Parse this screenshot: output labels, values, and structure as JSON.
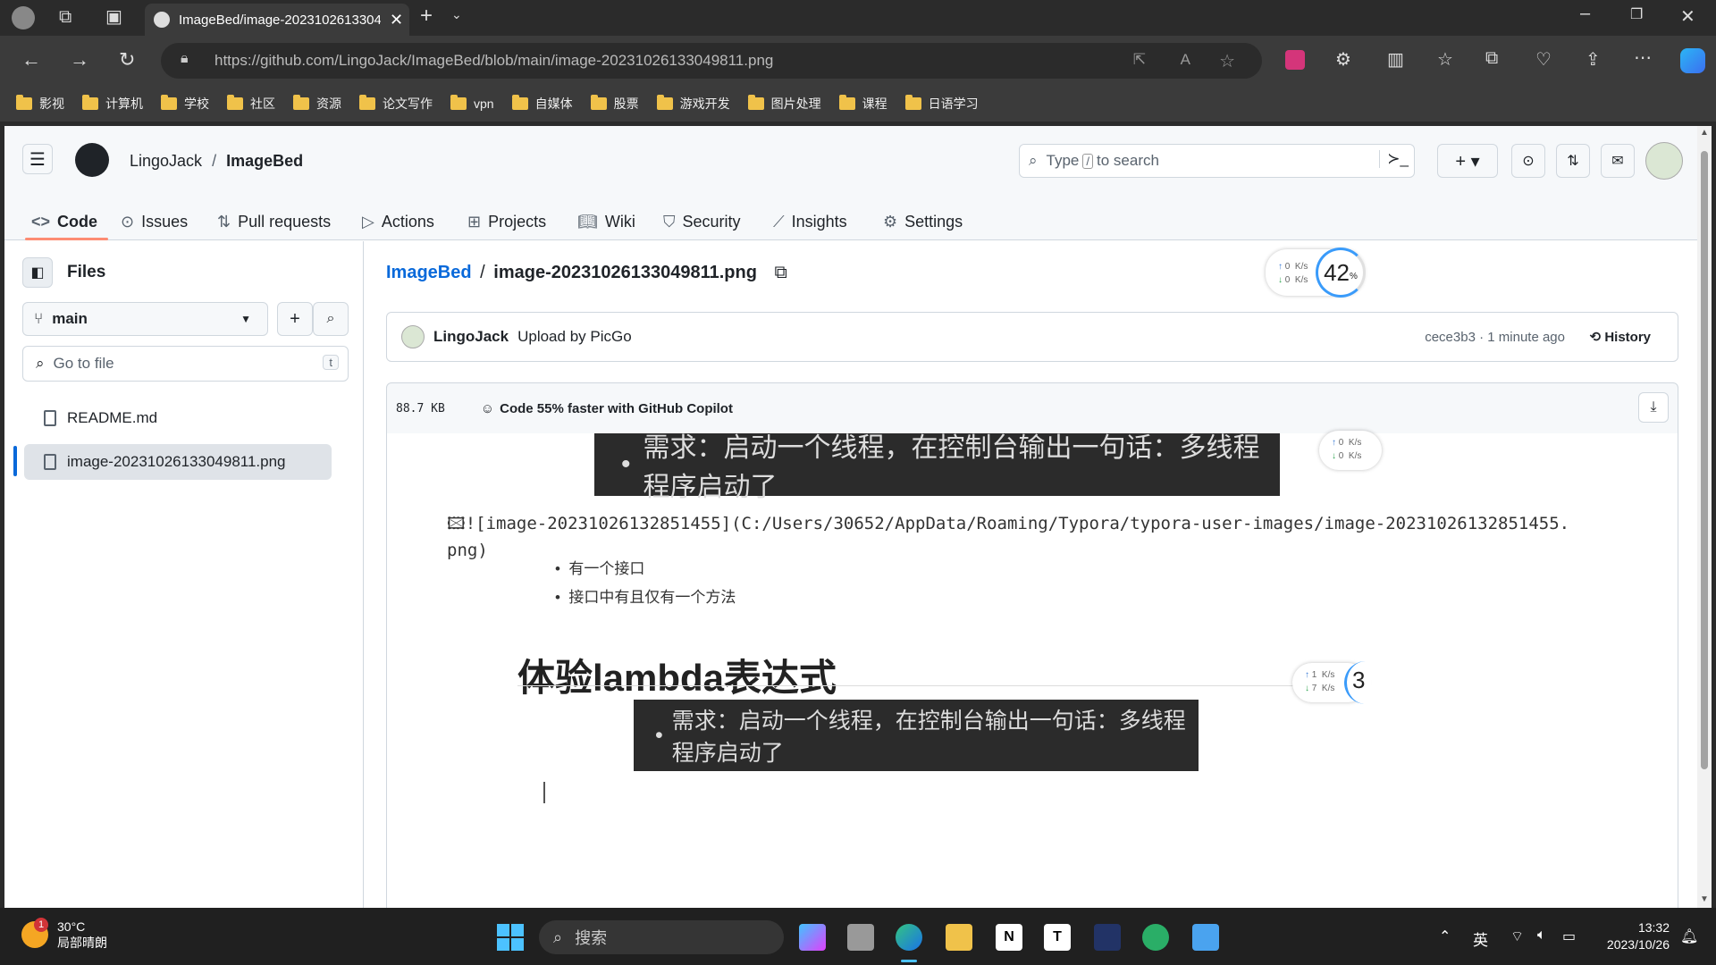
{
  "browser": {
    "tab_title": "ImageBed/image-20231026133049811.png",
    "url": "https://github.com/LingoJack/ImageBed/blob/main/image-20231026133049811.png",
    "bookmarks": [
      "影视",
      "计算机",
      "学校",
      "社区",
      "资源",
      "论文写作",
      "vpn",
      "自媒体",
      "股票",
      "游戏开发",
      "图片处理",
      "课程",
      "日语学习"
    ]
  },
  "repo": {
    "owner": "LingoJack",
    "separator": "/",
    "name": "ImageBed"
  },
  "search": {
    "placeholder_pre": "Type",
    "key": "/",
    "placeholder_post": "to search"
  },
  "nav": {
    "code": "Code",
    "issues": "Issues",
    "pulls": "Pull requests",
    "actions": "Actions",
    "projects": "Projects",
    "wiki": "Wiki",
    "security": "Security",
    "insights": "Insights",
    "settings": "Settings"
  },
  "sidebar": {
    "title": "Files",
    "branch": "main",
    "goto_placeholder": "Go to file",
    "goto_key": "t",
    "files": [
      "README.md",
      "image-20231026133049811.png"
    ]
  },
  "file": {
    "repo_link": "ImageBed",
    "sep": "/",
    "name": "image-20231026133049811.png",
    "author": "LingoJack",
    "commit_msg": "Upload by PicGo",
    "commit_meta": "cece3b3 · 1 minute ago",
    "history": "History",
    "size": "88.7 KB",
    "copilot": "Code 55% faster with GitHub Copilot"
  },
  "image_content": {
    "req1": "需求：启动一个线程，在控制台输出一句话：多线程程序启动了",
    "md_line1": "![image-20231026132851455](C:/Users/30652/AppData/Roaming/Typora/typora-user-images/image-20231026132851455.",
    "md_line2": "png)",
    "bullet1": "有一个接口",
    "bullet2": "接口中有且仅有一个方法",
    "heading": "体验lambda表达式",
    "req2": "需求：启动一个线程，在控制台输出一句话：多线程程序启动了"
  },
  "widgets": {
    "percent": "42",
    "percent_unit": "%",
    "up": "0",
    "down": "0",
    "unit": "K/s",
    "up2": "1",
    "down2": "7",
    "partial": "3"
  },
  "taskbar": {
    "temp": "30°C",
    "weather": "局部晴朗",
    "badge": "1",
    "search": "搜索",
    "lang": "英",
    "time": "13:32",
    "date": "2023/10/26"
  }
}
